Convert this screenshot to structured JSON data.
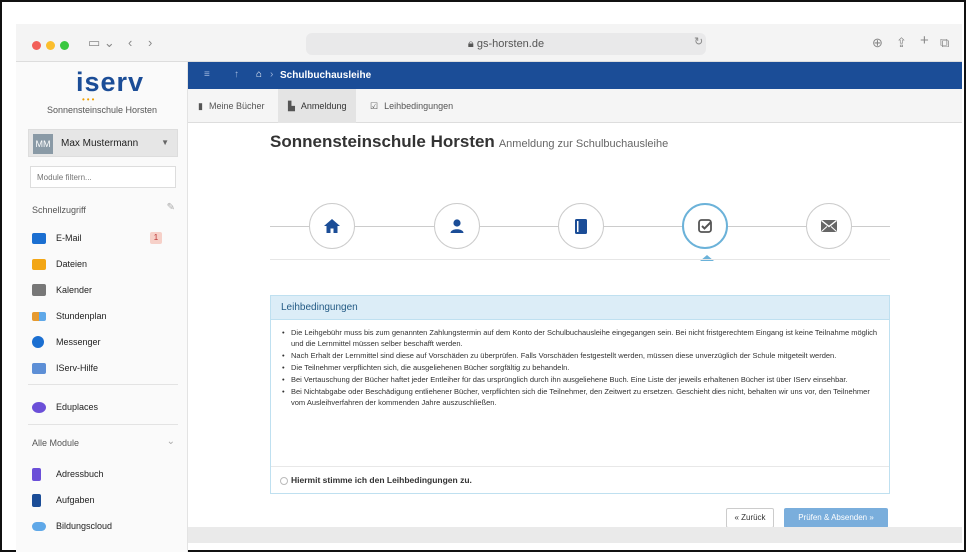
{
  "browser": {
    "url": "gs-horsten.de",
    "toolbar_icons": [
      "sidebar-toggle-icon",
      "back-icon",
      "forward-icon",
      "download-icon",
      "share-icon",
      "new-tab-icon",
      "tabs-icon"
    ]
  },
  "sidebar": {
    "logo": "iserv",
    "school": "Sonnensteinschule Horsten",
    "user": {
      "initials": "MM",
      "name": "Max Mustermann"
    },
    "filter_placeholder": "Module filtern...",
    "quick_access_label": "Schnellzugriff",
    "quick_items": [
      {
        "label": "E-Mail",
        "badge": "1",
        "color": "#1b6fd1",
        "icon": "mail-icon"
      },
      {
        "label": "Dateien",
        "color": "#f3a614",
        "icon": "folder-icon"
      },
      {
        "label": "Kalender",
        "color": "#777777",
        "icon": "calendar-icon"
      },
      {
        "label": "Stundenplan",
        "color": "#e69a2f",
        "icon": "timetable-icon"
      },
      {
        "label": "Messenger",
        "color": "#1b6fd1",
        "icon": "chat-icon"
      },
      {
        "label": "IServ-Hilfe",
        "color": "#5d8fd6",
        "icon": "help-icon"
      }
    ],
    "eduplaces": {
      "label": "Eduplaces",
      "color": "#6b4fd8",
      "icon": "eduplaces-icon"
    },
    "all_modules_label": "Alle Module",
    "modules": [
      {
        "label": "Adressbuch",
        "color": "#6b4fd8",
        "icon": "addressbook-icon"
      },
      {
        "label": "Aufgaben",
        "color": "#1b4d97",
        "icon": "tasks-icon"
      },
      {
        "label": "Bildungscloud",
        "color": "#5fa8e8",
        "icon": "cloud-icon"
      }
    ]
  },
  "appbar": {
    "title": "Schulbuchausleihe",
    "color": "#1b4d97"
  },
  "tabs": [
    {
      "label": "Meine Bücher",
      "icon": "book-icon",
      "active": false
    },
    {
      "label": "Anmeldung",
      "icon": "document-icon",
      "active": true
    },
    {
      "label": "Leihbedingungen",
      "icon": "checkbox-icon",
      "active": false
    }
  ],
  "page": {
    "title": "Sonnensteinschule Horsten",
    "subtitle": "Anmeldung zur Schulbuchausleihe"
  },
  "steps": [
    {
      "icon": "home-icon",
      "active": false
    },
    {
      "icon": "user-icon",
      "active": false
    },
    {
      "icon": "book-icon",
      "active": false
    },
    {
      "icon": "check-icon",
      "active": true
    },
    {
      "icon": "envelope-icon",
      "active": false
    }
  ],
  "panel": {
    "heading": "Leihbedingungen",
    "items": [
      "Die Leihgebühr muss bis zum genannten Zahlungstermin auf dem Konto der Schulbuchausleihe eingegangen sein. Bei nicht fristgerechtem Eingang ist keine Teilnahme möglich und die Lernmittel müssen selber beschafft werden.",
      "Nach Erhalt der Lernmittel sind diese auf Vorschäden zu überprüfen. Falls Vorschäden festgestellt werden, müssen diese unverzüglich der Schule mitgeteilt werden.",
      "Die Teilnehmer verpflichten sich, die ausgeliehenen Bücher sorgfältig zu behandeln.",
      "Bei Vertauschung der Bücher haftet jeder Entleiher für das ursprünglich durch ihn ausgeliehene Buch. Eine Liste der jeweils erhaltenen Bücher ist über IServ einsehbar.",
      "Bei Nichtabgabe oder Beschädigung entliehener Bücher, verpflichten sich die Teilnehmer, den Zeitwert zu ersetzen. Geschieht dies nicht, behalten wir uns vor, den Teilnehmer vom Ausleihverfahren der kommenden Jahre auszuschließen."
    ],
    "agree_label": "Hiermit stimme ich den Leihbedingungen zu."
  },
  "buttons": {
    "back": "« Zurück",
    "submit": "Prüfen & Absenden »"
  }
}
